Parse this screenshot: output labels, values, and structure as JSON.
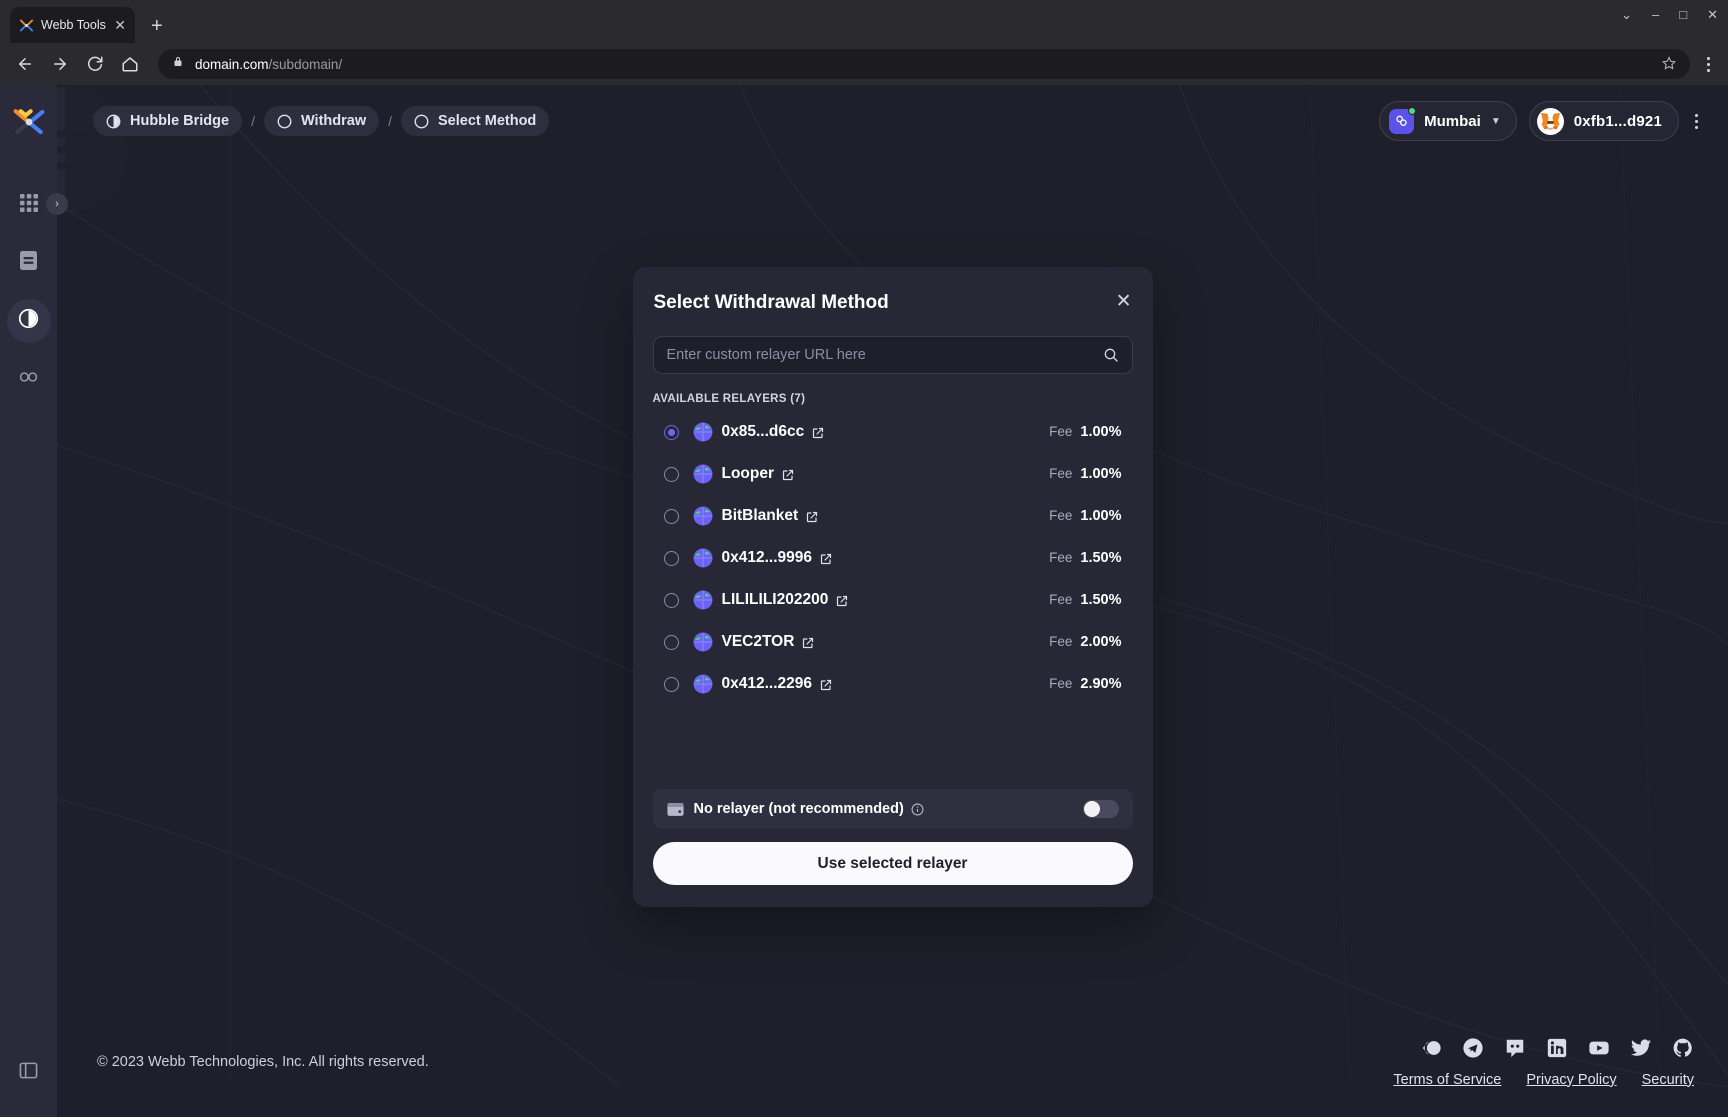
{
  "browser": {
    "tab": {
      "title": "Webb Tools",
      "favicon_icon": "webb-logo-icon",
      "close_icon": "close-icon"
    },
    "new_tab_label": "+",
    "window_controls": {
      "minimize": "–",
      "maximize": "□",
      "close": "✕",
      "chevron": "⌄"
    },
    "nav": {
      "back_icon": "arrow-left-icon",
      "forward_icon": "arrow-right-icon",
      "reload_icon": "reload-icon",
      "home_icon": "home-icon"
    },
    "url": {
      "domain": "domain.com",
      "path": "/subdomain/",
      "lock_icon": "lock-icon",
      "star_icon": "star-icon",
      "menu_icon": "kebab-menu-icon"
    }
  },
  "sidebar": {
    "logo_icon": "webb-logo-icon",
    "items": [
      {
        "name": "apps",
        "icon": "grid-icon",
        "active": false
      },
      {
        "name": "documents",
        "icon": "document-icon",
        "active": false
      },
      {
        "name": "bridge",
        "icon": "contrast-circle-icon",
        "active": true
      },
      {
        "name": "stats",
        "icon": "clover-icon",
        "active": false
      }
    ],
    "bottom_item": {
      "name": "book",
      "icon": "book-icon"
    },
    "collapse_icon": "chevron-right-icon"
  },
  "topbar": {
    "breadcrumb": [
      {
        "label": "Hubble Bridge",
        "icon": "contrast-circle-icon",
        "filled": true
      },
      {
        "label": "Withdraw",
        "icon": "circle-icon",
        "filled": true
      },
      {
        "label": "Select Method",
        "icon": "circle-icon",
        "filled": true
      }
    ],
    "separator": "/",
    "chain": {
      "name": "Mumbai",
      "avatar_icon": "polygon-icon",
      "status_dot_color": "#4ddb7d",
      "chevron_icon": "chevron-down-icon"
    },
    "account": {
      "address": "0xfb1...d921",
      "avatar_icon": "metamask-fox-icon"
    },
    "menu_icon": "kebab-menu-icon"
  },
  "modal": {
    "title": "Select Withdrawal Method",
    "close_icon": "close-icon",
    "search": {
      "placeholder": "Enter custom relayer URL here",
      "value": "",
      "icon": "search-icon"
    },
    "section_label": "AVAILABLE RELAYERS (7)",
    "fee_label": "Fee",
    "relayers": [
      {
        "name": "0x85...d6cc",
        "fee": "1.00%",
        "selected": true,
        "avatar_icon": "globe-icon",
        "external_icon": "external-link-icon"
      },
      {
        "name": "Looper",
        "fee": "1.00%",
        "selected": false,
        "avatar_icon": "globe-icon",
        "external_icon": "external-link-icon"
      },
      {
        "name": "BitBlanket",
        "fee": "1.00%",
        "selected": false,
        "avatar_icon": "globe-icon",
        "external_icon": "external-link-icon"
      },
      {
        "name": "0x412...9996",
        "fee": "1.50%",
        "selected": false,
        "avatar_icon": "globe-icon",
        "external_icon": "external-link-icon"
      },
      {
        "name": "LILILILI202200",
        "fee": "1.50%",
        "selected": false,
        "avatar_icon": "globe-icon",
        "external_icon": "external-link-icon"
      },
      {
        "name": "VEC2TOR",
        "fee": "2.00%",
        "selected": false,
        "avatar_icon": "globe-icon",
        "external_icon": "external-link-icon"
      },
      {
        "name": "0x412...2296",
        "fee": "2.90%",
        "selected": false,
        "avatar_icon": "globe-icon",
        "external_icon": "external-link-icon"
      }
    ],
    "no_relayer": {
      "label": "No relayer (not recommended)",
      "wallet_icon": "wallet-icon",
      "info_icon": "info-circle-icon",
      "toggle_on": false
    },
    "cta_label": "Use selected relayer"
  },
  "footer": {
    "copyright": "© 2023 Webb Technologies, Inc. All rights reserved.",
    "socials": [
      {
        "name": "commonwealth",
        "icon": "commonwealth-icon"
      },
      {
        "name": "telegram",
        "icon": "telegram-icon"
      },
      {
        "name": "discord",
        "icon": "discord-icon"
      },
      {
        "name": "linkedin",
        "icon": "linkedin-icon"
      },
      {
        "name": "youtube",
        "icon": "youtube-icon"
      },
      {
        "name": "twitter",
        "icon": "twitter-icon"
      },
      {
        "name": "github",
        "icon": "github-icon"
      }
    ],
    "links": [
      "Terms of Service",
      "Privacy Policy",
      "Security"
    ]
  },
  "colors": {
    "app_bg": "#1f1f2b",
    "sidebar_bg": "#2a2a3a",
    "modal_bg": "#272736",
    "accent": "#6a6ae8",
    "cta_bg": "#fafafc",
    "status_green": "#4ddb7d"
  }
}
